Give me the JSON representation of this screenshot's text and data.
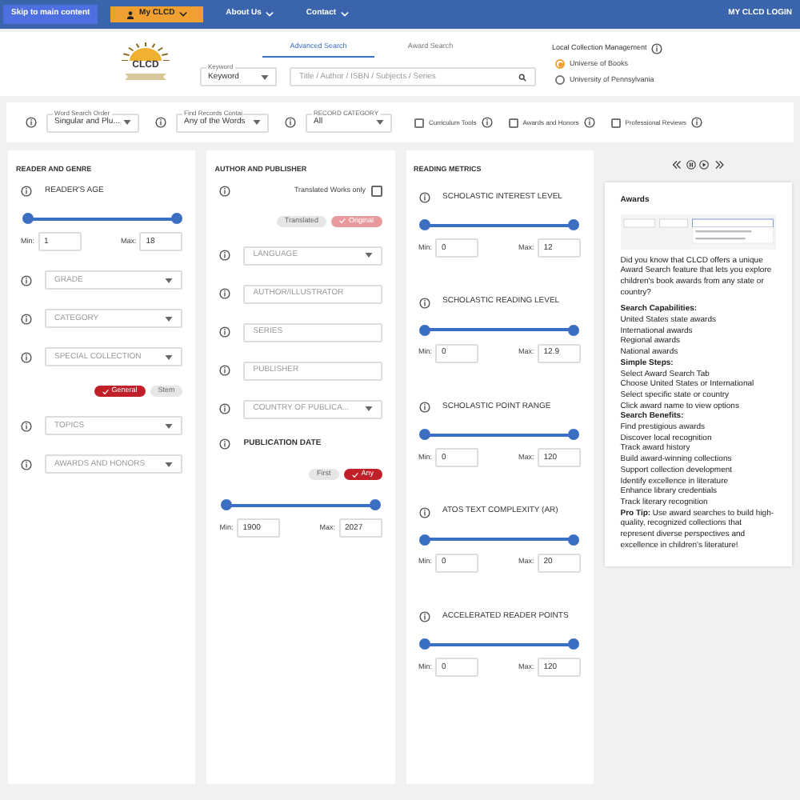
{
  "nav": {
    "skip_link": "Skip to main content",
    "menus": [
      {
        "label": "My CLCD",
        "kind": "highlight"
      },
      {
        "label": "About Us",
        "kind": "plain"
      },
      {
        "label": "Contact",
        "kind": "plain"
      }
    ],
    "login": "MY CLCD LOGIN"
  },
  "header": {
    "logo_text": "CLCD",
    "tabs": [
      {
        "label": "Advanced Search",
        "selected": true
      },
      {
        "label": "Award Search",
        "selected": false
      }
    ],
    "keyword_select": {
      "label": "Keyword",
      "value": "Keyword"
    },
    "search": {
      "placeholder": "Title / Author / ISBN / Subjects / Series"
    },
    "local_collection": {
      "title": "Local Collection Management",
      "options": [
        {
          "label": "Universe of Books",
          "selected": true
        },
        {
          "label": "University of Pennsylvania",
          "selected": false
        }
      ]
    }
  },
  "filters": {
    "selects": [
      {
        "label": "Word Search Order",
        "value": "Singular and Plu..."
      },
      {
        "label": "Find Records Contai",
        "value": "Any of the Words"
      },
      {
        "label": "RECORD CATEGORY",
        "value": "All"
      }
    ],
    "checkboxes": [
      {
        "label": "Curriculum Tools",
        "checked": false
      },
      {
        "label": "Awards and Honors",
        "checked": false
      },
      {
        "label": "Professional Reviews",
        "checked": false
      }
    ]
  },
  "columns": [
    {
      "title": "READER AND GENRE",
      "items": [
        {
          "kind": "range",
          "label": "READER'S AGE",
          "thumbs": [
            {
              "level": 0
            },
            {
              "level": 1
            }
          ],
          "min": {
            "label": "Min:",
            "value": "1"
          },
          "max": {
            "label": "Max:",
            "value": "18"
          }
        },
        {
          "kind": "select",
          "placeholder": "GRADE"
        },
        {
          "kind": "select",
          "placeholder": "CATEGORY"
        },
        {
          "kind": "select",
          "placeholder": "SPECIAL COLLECTION"
        },
        {
          "kind": "chips",
          "disabled": false,
          "chips": [
            {
              "label": "General",
              "selected": true
            },
            {
              "label": "Stem",
              "selected": false
            }
          ]
        },
        {
          "kind": "select",
          "placeholder": "TOPICS"
        },
        {
          "kind": "select",
          "placeholder": "AWARDS AND HONORS"
        }
      ]
    },
    {
      "title": "AUTHOR AND PUBLISHER",
      "items": [
        {
          "kind": "checkbox",
          "label": "Translated Works only",
          "checked": false
        },
        {
          "kind": "chips",
          "disabled": true,
          "chips": [
            {
              "label": "Translated",
              "selected": false
            },
            {
              "label": "Original",
              "selected": true
            }
          ]
        },
        {
          "kind": "select",
          "placeholder": "LANGUAGE"
        },
        {
          "kind": "input",
          "placeholder": "AUTHOR/ILLUSTRATOR"
        },
        {
          "kind": "input",
          "placeholder": "SERIES"
        },
        {
          "kind": "input",
          "placeholder": "PUBLISHER"
        },
        {
          "kind": "select",
          "placeholder": "COUNTRY OF PUBLICA..."
        },
        {
          "kind": "heading",
          "label": "PUBLICATION DATE"
        },
        {
          "kind": "chips",
          "disabled": false,
          "chips": [
            {
              "label": "First",
              "selected": false
            },
            {
              "label": "Any",
              "selected": true
            }
          ]
        },
        {
          "kind": "range",
          "thumbs": [
            {
              "level": 0
            },
            {
              "level": 1
            }
          ],
          "min": {
            "label": "Min:",
            "value": "1900"
          },
          "max": {
            "label": "Max:",
            "value": "2027"
          }
        }
      ]
    },
    {
      "title": "READING METRICS",
      "items": [
        {
          "kind": "range",
          "label": "SCHOLASTIC INTEREST LEVEL",
          "thumbs": [
            {
              "level": 0
            },
            {
              "level": 1
            }
          ],
          "min": {
            "label": "Min:",
            "value": "0"
          },
          "max": {
            "label": "Max:",
            "value": "12"
          }
        },
        {
          "kind": "range",
          "label": "SCHOLASTIC READING LEVEL",
          "thumbs": [
            {
              "level": 0
            },
            {
              "level": 1
            }
          ],
          "min": {
            "label": "Min:",
            "value": "0"
          },
          "max": {
            "label": "Max:",
            "value": "12.9"
          }
        },
        {
          "kind": "range",
          "label": "SCHOLASTIC POINT RANGE",
          "thumbs": [
            {
              "level": 0
            },
            {
              "level": 1
            }
          ],
          "min": {
            "label": "Min:",
            "value": "0"
          },
          "max": {
            "label": "Max:",
            "value": "120"
          }
        },
        {
          "kind": "range",
          "label": "ATOS TEXT COMPLEXITY (AR)",
          "thumbs": [
            {
              "level": 0
            },
            {
              "level": 1
            }
          ],
          "min": {
            "label": "Min:",
            "value": "0"
          },
          "max": {
            "label": "Max:",
            "value": "20"
          }
        },
        {
          "kind": "range",
          "label": "ACCELERATED READER POINTS",
          "thumbs": [
            {
              "level": 0
            },
            {
              "level": 1
            }
          ],
          "min": {
            "label": "Min:",
            "value": "0"
          },
          "max": {
            "label": "Max:",
            "value": "120"
          }
        }
      ]
    }
  ],
  "info_panel": {
    "title": "Awards",
    "intro": "Did you know that CLCD offers a unique Award Search feature that lets you explore children's book awards from any state or country?",
    "lines": [
      {
        "kind": "heading",
        "text": "Search Capabilities:"
      },
      {
        "kind": "item",
        "text": "United States state awards"
      },
      {
        "kind": "item",
        "text": "International awards"
      },
      {
        "kind": "item",
        "text": "Regional awards"
      },
      {
        "kind": "item",
        "text": "National awards"
      },
      {
        "kind": "heading",
        "text": "Simple Steps:"
      },
      {
        "kind": "item",
        "text": "Select Award Search Tab"
      },
      {
        "kind": "item",
        "text": "Choose United States or International"
      },
      {
        "kind": "item",
        "text": "Select specific state or country"
      },
      {
        "kind": "item",
        "text": "Click award name to view options"
      },
      {
        "kind": "heading",
        "text": "Search Benefits:"
      },
      {
        "kind": "item",
        "text": "Find prestigious awards"
      },
      {
        "kind": "item",
        "text": "Discover local recognition"
      },
      {
        "kind": "item",
        "text": "Track award history"
      },
      {
        "kind": "item",
        "text": "Build award-winning collections"
      },
      {
        "kind": "item",
        "text": "Support collection development"
      },
      {
        "kind": "item",
        "text": "Identify excellence in literature"
      },
      {
        "kind": "item",
        "text": "Enhance library credentials"
      },
      {
        "kind": "item",
        "text": "Track literary recognition"
      },
      {
        "kind": "tip",
        "text": "**Pro Tip:** Use award searches to build high-quality, recognized collections that represent diverse perspectives and excellence in children's literature!"
      }
    ]
  }
}
